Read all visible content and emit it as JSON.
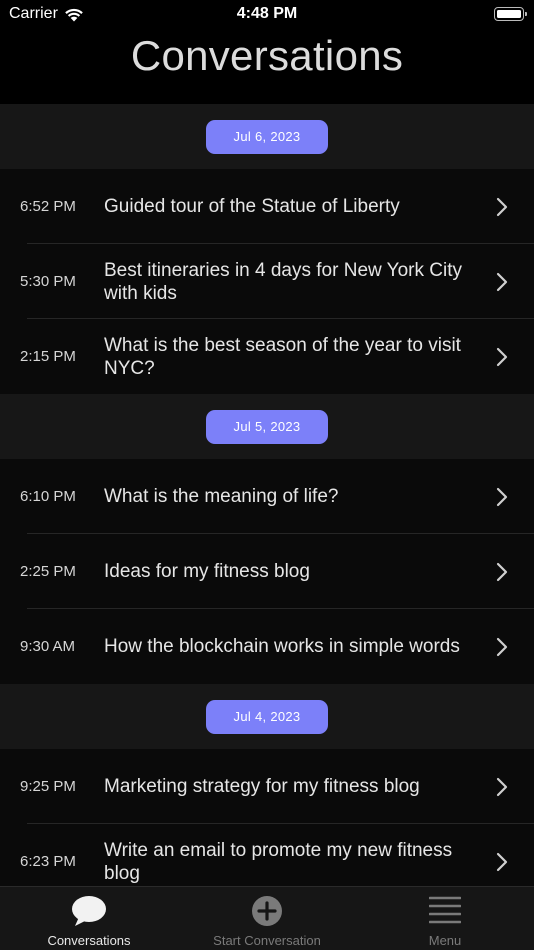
{
  "status_bar": {
    "carrier": "Carrier",
    "time": "4:48 PM"
  },
  "header": {
    "title": "Conversations"
  },
  "sections": [
    {
      "date": "Jul 6, 2023",
      "items": [
        {
          "time": "6:52 PM",
          "title": "Guided tour of the Statue of Liberty"
        },
        {
          "time": "5:30 PM",
          "title": "Best itineraries in 4 days for New York City with kids"
        },
        {
          "time": "2:15 PM",
          "title": "What is the best season of the year to visit NYC?"
        }
      ]
    },
    {
      "date": "Jul 5, 2023",
      "items": [
        {
          "time": "6:10 PM",
          "title": "What is the meaning of life?"
        },
        {
          "time": "2:25 PM",
          "title": "Ideas for my fitness blog"
        },
        {
          "time": "9:30 AM",
          "title": "How the blockchain works in simple words"
        }
      ]
    },
    {
      "date": "Jul 4, 2023",
      "items": [
        {
          "time": "9:25 PM",
          "title": "Marketing strategy for my fitness blog"
        },
        {
          "time": "6:23 PM",
          "title": "Write an email to promote my new fitness blog"
        }
      ]
    }
  ],
  "tab_bar": {
    "tabs": [
      {
        "label": "Conversations",
        "icon": "chat-bubble-icon",
        "active": true
      },
      {
        "label": "Start Conversation",
        "icon": "plus-circle-icon",
        "active": false
      },
      {
        "label": "Menu",
        "icon": "hamburger-menu-icon",
        "active": false
      }
    ]
  },
  "colors": {
    "accent": "#7c80f9",
    "background": "#000000",
    "row": "#0a0a0a",
    "section": "#171717"
  }
}
